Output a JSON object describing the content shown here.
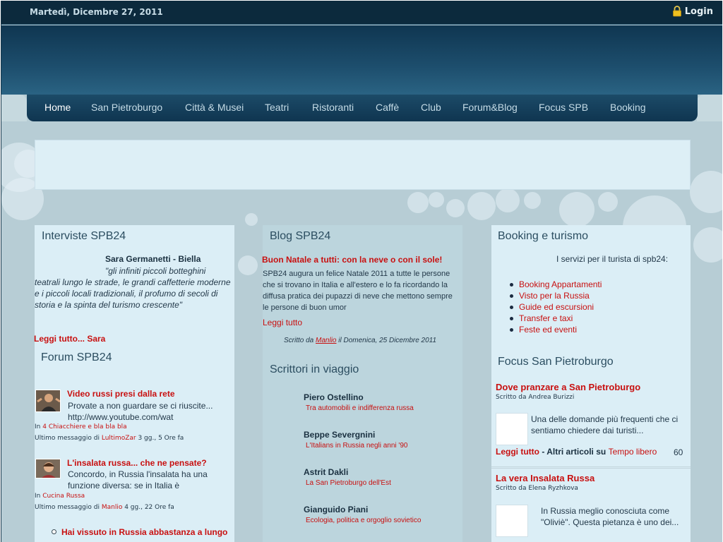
{
  "header": {
    "date": "Martedì, Dicembre 27, 2011",
    "login_label": "Login",
    "lock_icon": "lock-icon"
  },
  "nav": {
    "items": [
      {
        "label": "Home",
        "active": true
      },
      {
        "label": "San Pietroburgo"
      },
      {
        "label": "Città & Musei"
      },
      {
        "label": "Teatri"
      },
      {
        "label": "Ristoranti"
      },
      {
        "label": "Caffè"
      },
      {
        "label": "Club"
      },
      {
        "label": "Forum&Blog"
      },
      {
        "label": "Focus SPB"
      },
      {
        "label": "Booking"
      }
    ]
  },
  "interviste": {
    "title": "Interviste SPB24",
    "name": "Sara Germanetti - Biella",
    "quote": "\"gli infiniti piccoli botteghini teatrali lungo le strade, le grandi caffetterie moderne e i piccoli locali tradizionali, il profumo di secoli di storia e la spinta del turismo crescente\"",
    "more": "Leggi tutto... Sara"
  },
  "forum": {
    "title": "Forum SPB24",
    "posts": [
      {
        "title": "Video russi presi dalla rete",
        "text": "Provate a non guardare se ci riuscite... http://www.youtube.com/wat",
        "in_label": "In",
        "category": "4 Chiacchiere e bla bla bla",
        "last_label": "Ultimo messaggio di",
        "author": "LultimoZar",
        "ago": "3 gg., 5 Ore fa"
      },
      {
        "title": "L'insalata russa... che ne pensate?",
        "text": "Concordo, in Russia l'insalata ha una funzione diversa: se in Italia è",
        "in_label": "In",
        "category": "Cucina Russa",
        "last_label": "Ultimo messaggio di",
        "author": "Manlio",
        "ago": "4 gg., 22 Ore fa"
      },
      {
        "title": "Hai vissuto in Russia abbastanza a lungo"
      }
    ]
  },
  "blog": {
    "title": "Blog SPB24",
    "headline": "Buon Natale a tutti: con la neve o con il sole!",
    "text": "SPB24 augura un felice Natale 2011 a tutte le persone che si trovano in Italia e all'estero e lo fa ricordando la diffusa pratica dei  pupazzi di neve che mettono sempre le persone di buon umor",
    "more": "Leggi tutto",
    "by_prefix": "Scritto da",
    "by_author": "Manlio",
    "by_suffix": "il Domenica, 25 Dicembre 2011"
  },
  "scrittori": {
    "title": "Scrittori in viaggio",
    "writers": [
      {
        "name": "Piero Ostellino",
        "sub": "Tra automobili e indifferenza russa"
      },
      {
        "name": "Beppe Severgnini",
        "sub": "L'Italians in Russia negli anni '90"
      },
      {
        "name": "Astrit Dakli",
        "sub": "La San Pietroburgo dell'Est"
      },
      {
        "name": "Gianguido Piani",
        "sub": "Ecologia, politica e orgoglio sovietico"
      }
    ]
  },
  "booking": {
    "title": "Booking e turismo",
    "intro": "I servizi per il turista di spb24:",
    "items": [
      "Booking Appartamenti",
      "Visto per la Russia",
      "Guide ed escursioni",
      "Transfer e taxi",
      "Feste ed eventi"
    ]
  },
  "focus": {
    "title": "Focus San Pietroburgo",
    "articles": [
      {
        "title": "Dove pranzare a San Pietroburgo",
        "by": "Scritto da Andrea Burizzi",
        "text": "Una delle domande più frequenti che ci sentiamo chiedere dai turisti...",
        "more": "Leggi tutto",
        "sep": " - Altri articoli su ",
        "category": "Tempo libero",
        "count": "60"
      },
      {
        "title": "La vera Insalata Russa",
        "by": "Scritto da Elena Ryzhkova",
        "text": "In Russia meglio conosciuta come \"Oliviè\". Questa pietanza è uno dei..."
      }
    ]
  },
  "colors": {
    "accent_red": "#c81010",
    "nav_bg": "#0f3550",
    "page_bg": "#b7cdd5"
  }
}
